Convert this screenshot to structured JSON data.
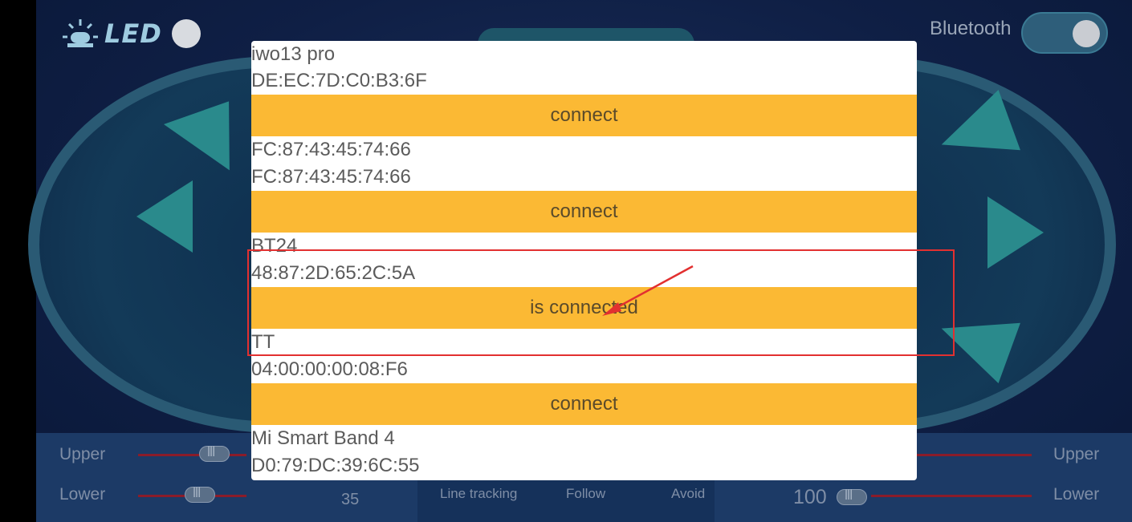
{
  "header": {
    "led_label": "LED",
    "bluetooth_label": "Bluetooth"
  },
  "controls": {
    "upper_left": "Upper",
    "lower_left": "Lower",
    "upper_right": "Upper",
    "lower_right": "Lower",
    "speed_left": "35",
    "speed_right": "100",
    "modes": [
      "Line tracking",
      "Follow",
      "Avoid"
    ]
  },
  "dialog": {
    "devices": [
      {
        "name": "iwo13 pro",
        "mac": "DE:EC:7D:C0:B3:6F",
        "action": "connect"
      },
      {
        "name": "FC:87:43:45:74:66",
        "mac": "FC:87:43:45:74:66",
        "action": "connect"
      },
      {
        "name": "BT24",
        "mac": "48:87:2D:65:2C:5A",
        "action": "is connected"
      },
      {
        "name": "TT",
        "mac": "04:00:00:00:08:F6",
        "action": "connect"
      },
      {
        "name": "Mi Smart Band 4",
        "mac": "D0:79:DC:39:6C:55",
        "action": ""
      }
    ]
  },
  "colors": {
    "button_bg": "#fbb934",
    "annotation": "#e23030"
  }
}
